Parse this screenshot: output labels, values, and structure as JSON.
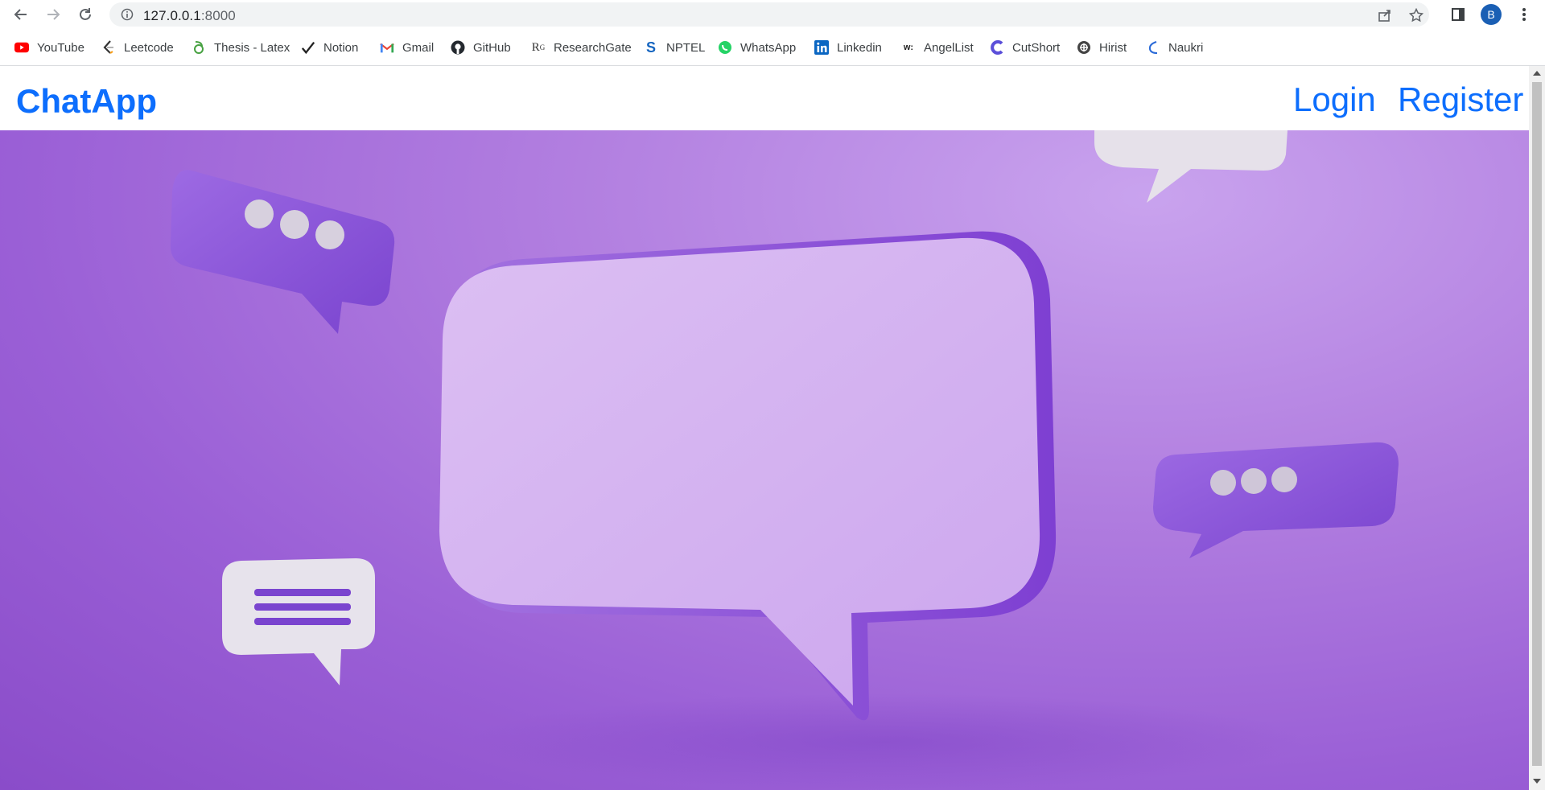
{
  "browser": {
    "url_host": "127.0.0.1",
    "url_port": ":8000",
    "avatar_letter": "B",
    "bookmarks": [
      {
        "label": "YouTube",
        "icon": "youtube-icon"
      },
      {
        "label": "Leetcode",
        "icon": "leetcode-icon"
      },
      {
        "label": "Thesis - Latex",
        "icon": "overleaf-icon"
      },
      {
        "label": "Notion",
        "icon": "notion-icon"
      },
      {
        "label": "Gmail",
        "icon": "gmail-icon"
      },
      {
        "label": "GitHub",
        "icon": "github-icon"
      },
      {
        "label": "ResearchGate",
        "icon": "researchgate-icon"
      },
      {
        "label": "NPTEL",
        "icon": "nptel-icon"
      },
      {
        "label": "WhatsApp",
        "icon": "whatsapp-icon"
      },
      {
        "label": "Linkedin",
        "icon": "linkedin-icon"
      },
      {
        "label": "AngelList",
        "icon": "angellist-icon"
      },
      {
        "label": "CutShort",
        "icon": "cutshort-icon"
      },
      {
        "label": "Hirist",
        "icon": "hirist-icon"
      },
      {
        "label": "Naukri",
        "icon": "naukri-icon"
      }
    ]
  },
  "page": {
    "brand": "ChatApp",
    "nav": {
      "login": "Login",
      "register": "Register"
    }
  },
  "colors": {
    "brand_blue": "#0d6efd",
    "hero_purple": "#9a5fd6"
  }
}
